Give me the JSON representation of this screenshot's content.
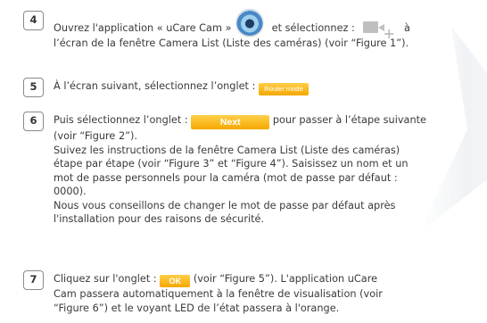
{
  "steps": [
    {
      "number": "4",
      "line1_before": "Ouvrez l'application « uCare Cam »",
      "line1_after": "et sélectionnez :",
      "line1_end": "à",
      "line2": "l’écran de la fenêtre Camera List (Liste des caméras) (voir “Figure 1”)."
    },
    {
      "number": "5",
      "line1_before": "À l’écran suivant, sélectionnez l’onglet :",
      "button_label": "Router mode"
    },
    {
      "number": "6",
      "line1_before": "Puis sélectionnez l’onglet :",
      "button_label": "Next",
      "line1_after": "pour passer à l’étape suivante",
      "lines": [
        "(voir “Figure 2”).",
        "Suivez les instructions de la fenêtre Camera List (Liste des caméras)",
        "étape par étape (voir “Figure 3” et “Figure 4”). Saisissez un nom et un",
        "mot de passe personnels pour la caméra (mot de passe par défaut :",
        "0000).",
        "Nous vous conseillons de changer le mot de passe par défaut après",
        "l'installation pour des raisons de sécurité."
      ]
    },
    {
      "number": "7",
      "line1_before": "Cliquez sur l'onglet :",
      "button_label": "OK",
      "line1_after": "(voir “Figure 5”). L'application uCare",
      "lines": [
        "Cam passera automatiquement à la fenêtre de visualisation (voir",
        "“Figure 6”) et le voyant LED de l’état passera à l'orange."
      ]
    }
  ],
  "icons": {
    "app_icon": "ucare-cam-app-icon",
    "add_camera_icon": "add-camera-icon"
  },
  "colors": {
    "button_orange": "#f5a800",
    "text": "#3a3a3a",
    "number_border": "#8a8a8a",
    "icon_gray": "#bfbfbf"
  }
}
